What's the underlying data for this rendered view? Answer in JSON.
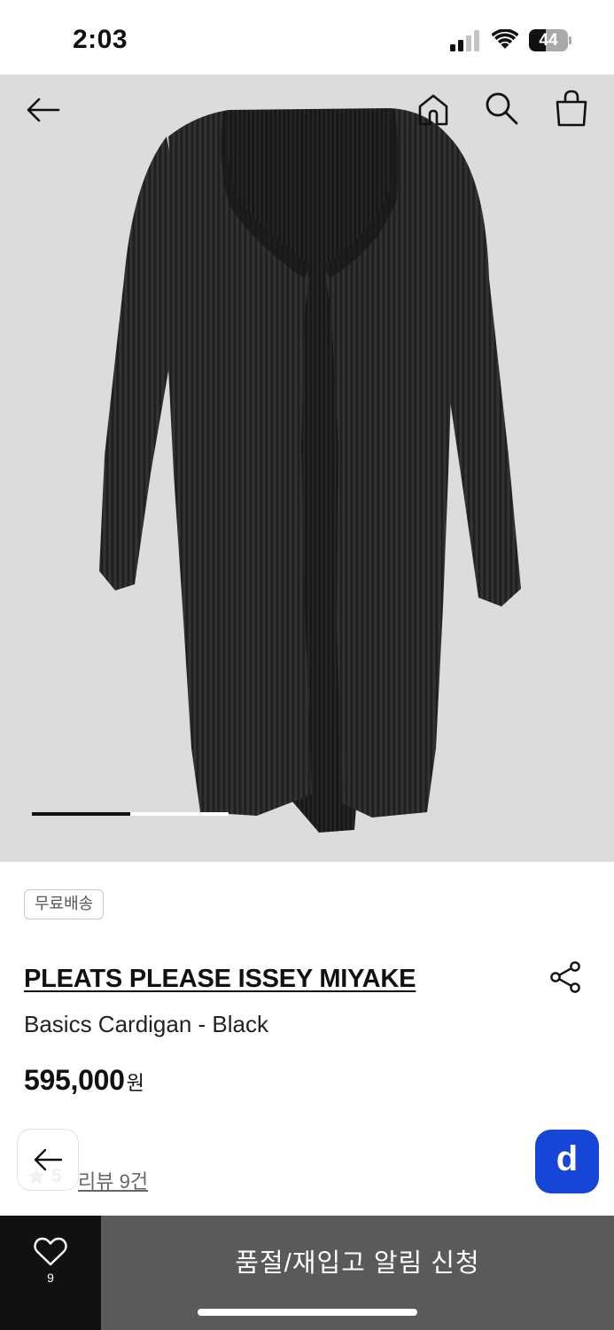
{
  "status_bar": {
    "time": "2:03",
    "battery_level": "44",
    "battery_fraction": 0.44
  },
  "header": {
    "back_icon": "arrow-left-icon",
    "home_icon": "home-icon",
    "search_icon": "search-icon",
    "bag_icon": "shopping-bag-icon"
  },
  "gallery": {
    "current_index": 1,
    "progress_fraction": 0.5,
    "background_color": "#dcdcdc",
    "garment_color": "#2a2a2a"
  },
  "product": {
    "badge": "무료배송",
    "brand": "PLEATS PLEASE ISSEY MIYAKE",
    "name": "Basics Cardigan - Black",
    "price": "595,000",
    "price_unit": "원",
    "rating_score": "5",
    "review_link": "리뷰 9건"
  },
  "bottom_bar": {
    "like_count": "9",
    "notify_label": "품절/재입고 알림 신청"
  },
  "chat_fab": {
    "label": "d",
    "color": "#1546d8"
  }
}
